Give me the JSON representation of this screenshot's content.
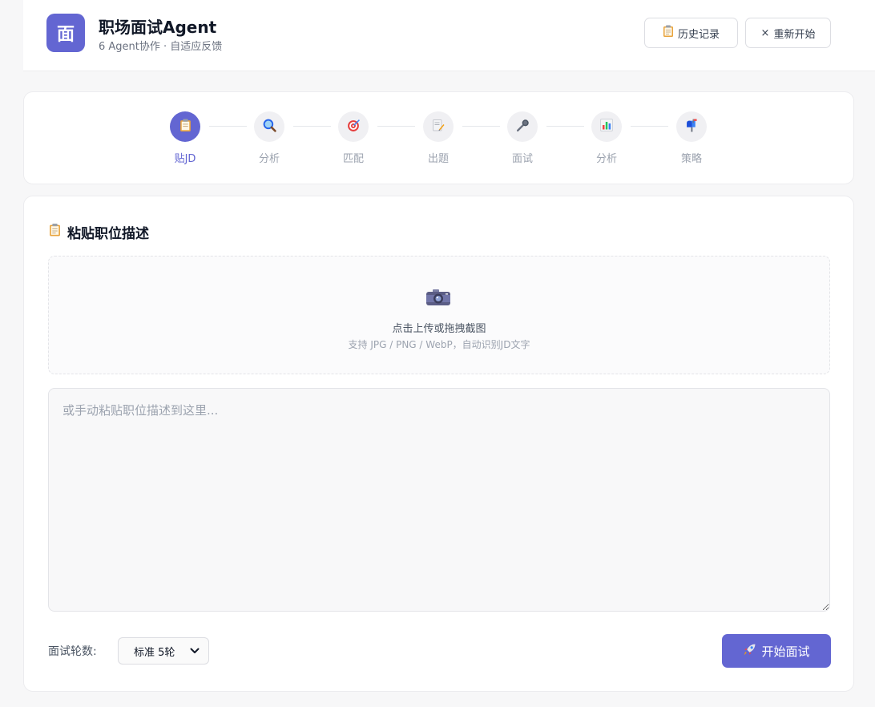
{
  "header": {
    "logo_char": "面",
    "title": "职场面试Agent",
    "subtitle": "6 Agent协作 · 自适应反馈",
    "history_label": "历史记录",
    "restart_label": "重新开始",
    "restart_icon": "×"
  },
  "steps": [
    {
      "label": "贴JD",
      "icon": "clipboard-icon",
      "active": true
    },
    {
      "label": "分析",
      "icon": "magnifier-icon",
      "active": false
    },
    {
      "label": "匹配",
      "icon": "target-icon",
      "active": false
    },
    {
      "label": "出题",
      "icon": "memo-icon",
      "active": false
    },
    {
      "label": "面试",
      "icon": "microphone-icon",
      "active": false
    },
    {
      "label": "分析",
      "icon": "bar-chart-icon",
      "active": false
    },
    {
      "label": "策略",
      "icon": "mailbox-icon",
      "active": false
    }
  ],
  "main": {
    "section_title": "粘贴职位描述",
    "upload_primary": "点击上传或拖拽截图",
    "upload_secondary": "支持 JPG / PNG / WebP，自动识别JD文字",
    "textarea_placeholder": "或手动粘贴职位描述到这里...",
    "textarea_value": "",
    "rounds_label": "面试轮数:",
    "rounds_selected": "标准 5轮",
    "start_label": "开始面试"
  },
  "colors": {
    "accent": "#6366d2",
    "background": "#f7f7f8"
  }
}
